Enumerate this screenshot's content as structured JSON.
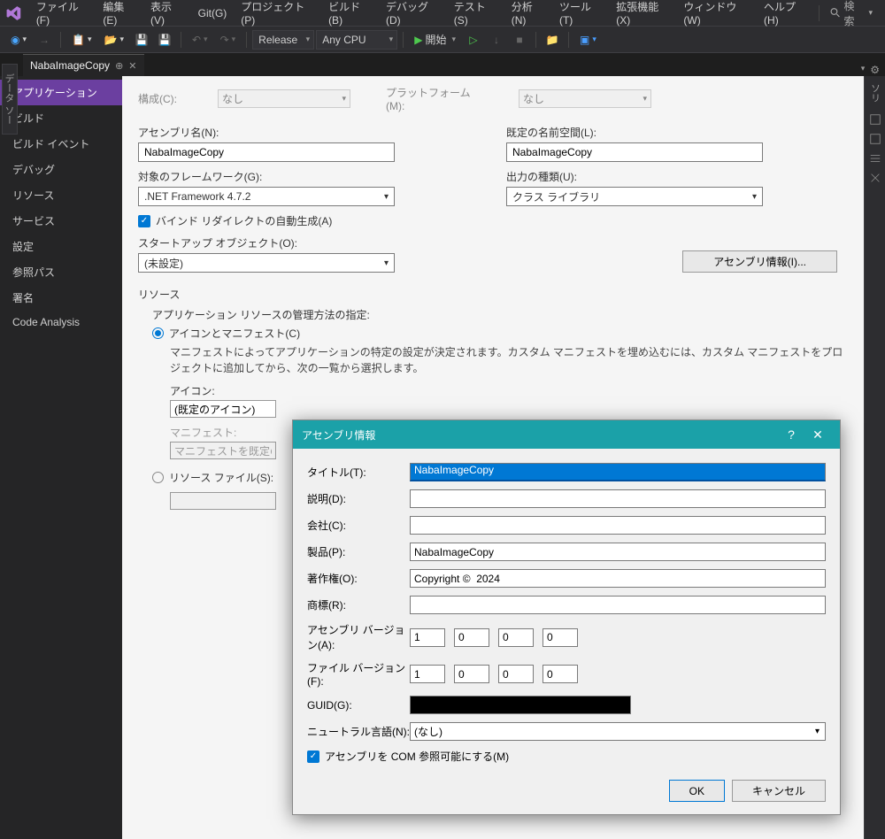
{
  "menu": {
    "items": [
      "ファイル(F)",
      "編集(E)",
      "表示(V)",
      "Git(G)",
      "プロジェクト(P)",
      "ビルド(B)",
      "デバッグ(D)",
      "テスト(S)",
      "分析(N)",
      "ツール(T)",
      "拡張機能(X)",
      "ウィンドウ(W)",
      "ヘルプ(H)"
    ],
    "search": "検索"
  },
  "toolbar": {
    "config": "Release",
    "platform": "Any CPU",
    "start": "開始"
  },
  "vtab": "データ ソース",
  "doctab": {
    "name": "NabaImageCopy"
  },
  "sidebar": {
    "items": [
      "アプリケーション",
      "ビルド",
      "ビルド イベント",
      "デバッグ",
      "リソース",
      "サービス",
      "設定",
      "参照パス",
      "署名",
      "Code Analysis"
    ]
  },
  "page": {
    "configLabel": "構成(C):",
    "configValue": "なし",
    "platformLabel": "プラットフォーム(M):",
    "platformValue": "なし",
    "assemblyNameLabel": "アセンブリ名(N):",
    "assemblyNameValue": "NabaImageCopy",
    "defaultNsLabel": "既定の名前空間(L):",
    "defaultNsValue": "NabaImageCopy",
    "frameworkLabel": "対象のフレームワーク(G):",
    "frameworkValue": ".NET Framework 4.7.2",
    "outputLabel": "出力の種類(U):",
    "outputValue": "クラス ライブラリ",
    "bindRedirect": "バインド リダイレクトの自動生成(A)",
    "startupLabel": "スタートアップ オブジェクト(O):",
    "startupValue": "(未設定)",
    "assemblyInfoBtn": "アセンブリ情報(I)...",
    "resourcesLegend": "リソース",
    "resourcesDesc": "アプリケーション リソースの管理方法の指定:",
    "iconManifestRadio": "アイコンとマニフェスト(C)",
    "iconManifestDesc": "マニフェストによってアプリケーションの特定の設定が決定されます。カスタム マニフェストを埋め込むには、カスタム マニフェストをプロジェクトに追加してから、次の一覧から選択します。",
    "iconLabel": "アイコン:",
    "iconValue": "(既定のアイコン)",
    "manifestLabel": "マニフェスト:",
    "manifestValue": "マニフェストを既定の設定",
    "resourceFileRadio": "リソース ファイル(S):"
  },
  "rightpanel": {
    "label": "ソリ"
  },
  "dialog": {
    "title": "アセンブリ情報",
    "titleLabel": "タイトル(T):",
    "titleValue": "NabaImageCopy",
    "descLabel": "説明(D):",
    "descValue": "",
    "companyLabel": "会社(C):",
    "companyValue": "",
    "productLabel": "製品(P):",
    "productValue": "NabaImageCopy",
    "copyrightLabel": "著作権(O):",
    "copyrightValue": "Copyright ©  2024",
    "trademarkLabel": "商標(R):",
    "trademarkValue": "",
    "asmVersionLabel": "アセンブリ バージョン(A):",
    "asmVersion": [
      "1",
      "0",
      "0",
      "0"
    ],
    "fileVersionLabel": "ファイル バージョン(F):",
    "fileVersion": [
      "1",
      "0",
      "0",
      "0"
    ],
    "guidLabel": "GUID(G):",
    "neutralLangLabel": "ニュートラル言語(N):",
    "neutralLangValue": "(なし)",
    "comVisible": "アセンブリを COM 参照可能にする(M)",
    "ok": "OK",
    "cancel": "キャンセル"
  }
}
